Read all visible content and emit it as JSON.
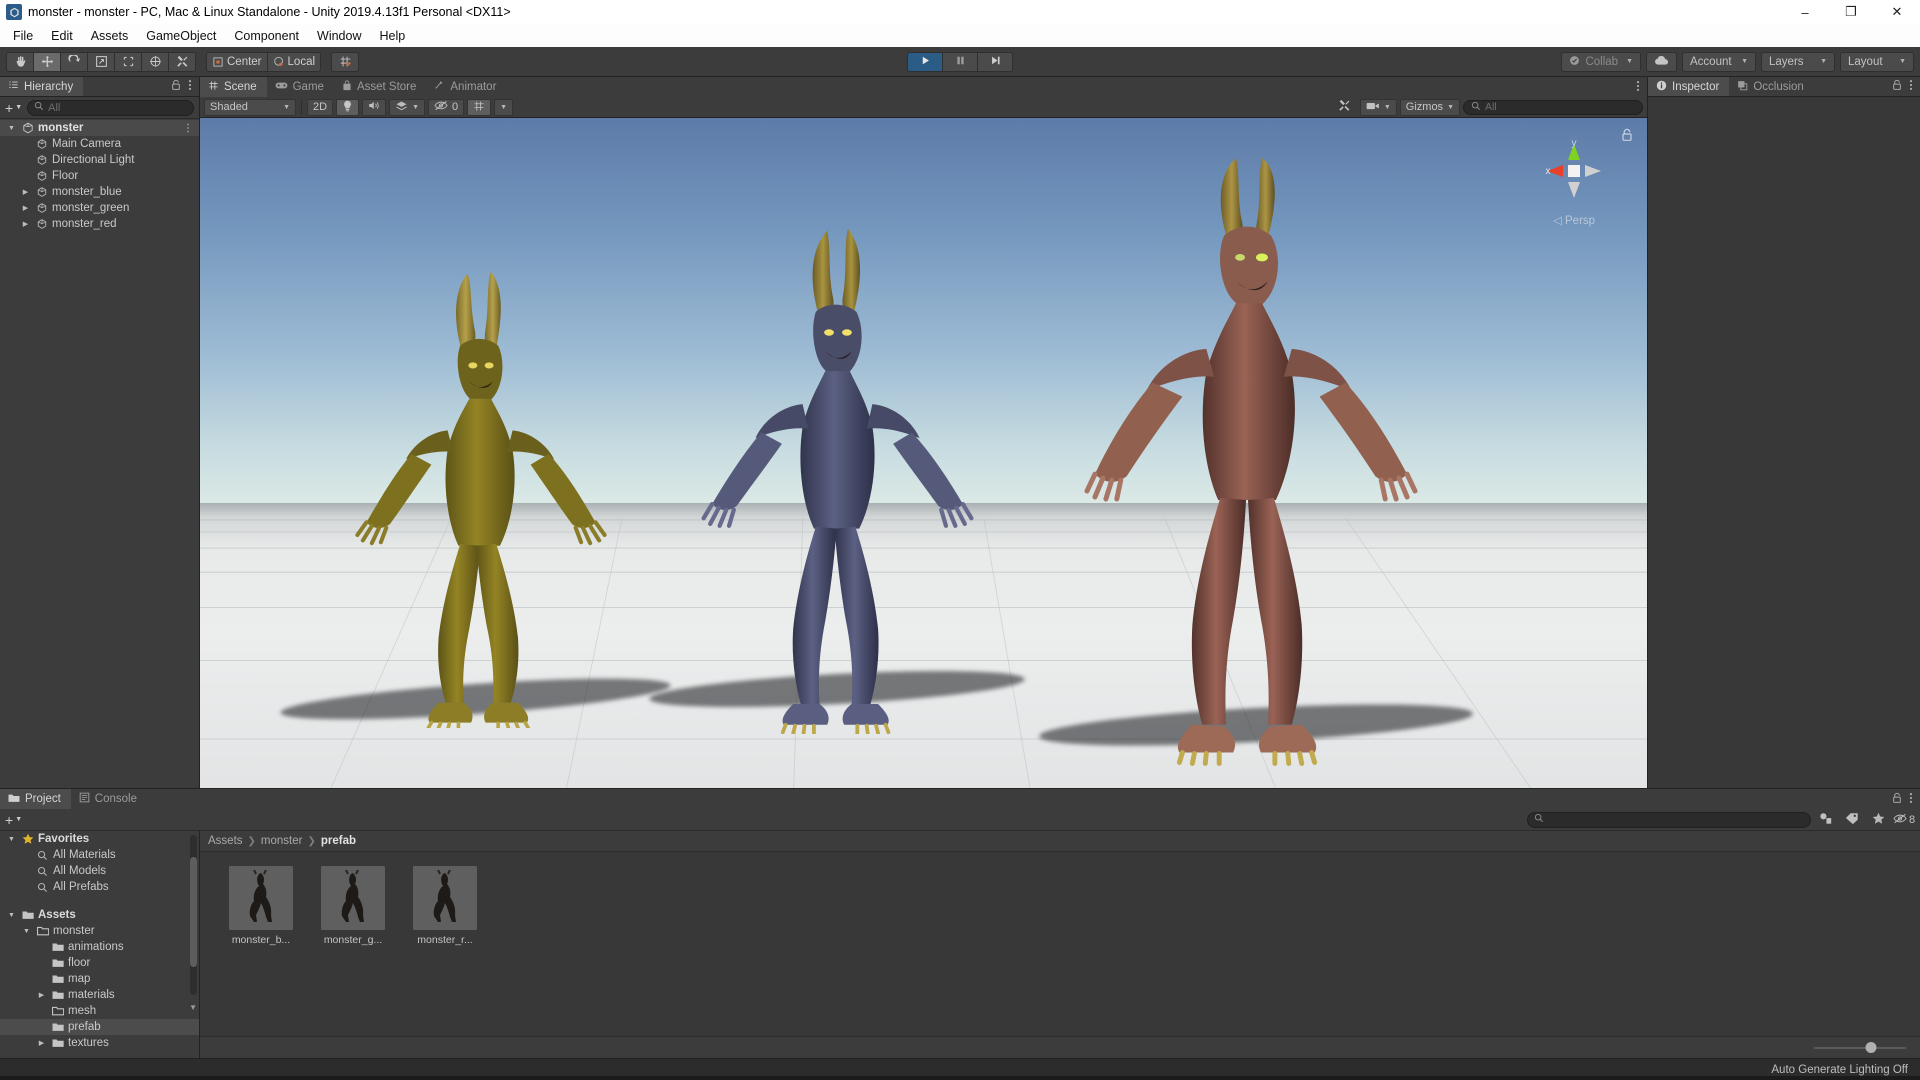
{
  "window": {
    "title": "monster - monster - PC, Mac & Linux Standalone - Unity 2019.4.13f1 Personal <DX11>",
    "app_icon": "unity-icon",
    "minimize": "–",
    "maximize": "❐",
    "close": "✕"
  },
  "menu": {
    "items": [
      "File",
      "Edit",
      "Assets",
      "GameObject",
      "Component",
      "Window",
      "Help"
    ]
  },
  "toolbar": {
    "tools": [
      {
        "name": "hand-tool",
        "icon": "hand-icon",
        "active": false
      },
      {
        "name": "move-tool",
        "icon": "move-icon",
        "active": true
      },
      {
        "name": "rotate-tool",
        "icon": "rotate-icon",
        "active": false
      },
      {
        "name": "scale-tool",
        "icon": "scale-icon",
        "active": false
      },
      {
        "name": "rect-tool",
        "icon": "rect-transform-icon",
        "active": false
      },
      {
        "name": "transform-tool",
        "icon": "transform-icon",
        "active": false
      },
      {
        "name": "custom-editor-tool",
        "icon": "wrench-icon",
        "active": false
      }
    ],
    "pivot_mode": "Center",
    "pivot_rotation": "Local",
    "grid_snap_icon": "grid-snap-icon",
    "play": "play-icon",
    "pause": "pause-icon",
    "step": "step-icon",
    "collab": "Collab",
    "cloud_icon": "cloud-icon",
    "account": "Account",
    "layers": "Layers",
    "layout": "Layout"
  },
  "hierarchy": {
    "tab": "Hierarchy",
    "tab_icon": "hierarchy-icon",
    "lock_icon": "lock-icon",
    "menu_icon": "kebab-icon",
    "add_label": "+",
    "search_placeholder": "All",
    "search_value": "",
    "items": [
      {
        "label": "monster",
        "depth": 0,
        "icon": "scene-icon",
        "expanded": true,
        "is_scene": true,
        "has_children": true
      },
      {
        "label": "Main Camera",
        "depth": 1,
        "icon": "gameobject-icon",
        "has_children": false
      },
      {
        "label": "Directional Light",
        "depth": 1,
        "icon": "gameobject-icon",
        "has_children": false
      },
      {
        "label": "Floor",
        "depth": 1,
        "icon": "gameobject-icon",
        "has_children": false
      },
      {
        "label": "monster_blue",
        "depth": 1,
        "icon": "gameobject-icon",
        "has_children": true
      },
      {
        "label": "monster_green",
        "depth": 1,
        "icon": "gameobject-icon",
        "has_children": true
      },
      {
        "label": "monster_red",
        "depth": 1,
        "icon": "gameobject-icon",
        "has_children": true
      }
    ]
  },
  "scene_view": {
    "tabs": [
      {
        "label": "Scene",
        "icon": "scene-tab-icon",
        "active": true
      },
      {
        "label": "Game",
        "icon": "game-tab-icon",
        "active": false
      },
      {
        "label": "Asset Store",
        "icon": "store-tab-icon",
        "active": false
      },
      {
        "label": "Animator",
        "icon": "animator-tab-icon",
        "active": false
      }
    ],
    "menu_icon": "kebab-icon",
    "draw_mode": "Shaded",
    "mode_2d": "2D",
    "lighting_icon": "lightbulb-icon",
    "audio_icon": "audio-icon",
    "fx_icon": "effects-icon",
    "hidden_count": "0",
    "hidden_icon": "eye-off-icon",
    "grid_icon": "grid-icon",
    "tools_icon": "tools-icon",
    "camera_icon": "camera-icon",
    "gizmos": "Gizmos",
    "search_placeholder": "All",
    "search_value": "",
    "projection": "Persp",
    "projection_prefix": "◁",
    "axis_x": "x",
    "axis_y": "y",
    "lock_icon": "lock-open-icon",
    "objects": [
      {
        "name": "monster_green",
        "color": "#8a7a2e"
      },
      {
        "name": "monster_blue",
        "color": "#4e5370"
      },
      {
        "name": "monster_red",
        "color": "#8e5a4e"
      }
    ]
  },
  "inspector": {
    "tabs": [
      {
        "label": "Inspector",
        "icon": "info-icon",
        "active": true
      },
      {
        "label": "Occlusion",
        "icon": "occlusion-icon",
        "active": false
      }
    ],
    "lock_icon": "lock-icon",
    "menu_icon": "kebab-icon"
  },
  "project": {
    "tabs": [
      {
        "label": "Project",
        "icon": "folder-icon",
        "active": true
      },
      {
        "label": "Console",
        "icon": "console-icon",
        "active": false
      }
    ],
    "lock_icon": "lock-icon",
    "menu_icon": "kebab-icon",
    "add_label": "+",
    "search_placeholder": "",
    "search_value": "",
    "filter_type_icon": "filter-type-icon",
    "filter_label_icon": "filter-label-icon",
    "favorite_icon": "star-icon",
    "hidden_count": "8",
    "hidden_icon": "eye-off-icon",
    "tree": [
      {
        "label": "Favorites",
        "depth": 0,
        "icon": "star-icon",
        "expanded": true,
        "bold": true,
        "has_children": true
      },
      {
        "label": "All Materials",
        "depth": 1,
        "icon": "search-icon",
        "has_children": false
      },
      {
        "label": "All Models",
        "depth": 1,
        "icon": "search-icon",
        "has_children": false
      },
      {
        "label": "All Prefabs",
        "depth": 1,
        "icon": "search-icon",
        "has_children": false
      },
      {
        "label": "",
        "depth": 0,
        "icon": "spacer",
        "spacer": true
      },
      {
        "label": "Assets",
        "depth": 0,
        "icon": "folder-icon",
        "expanded": true,
        "bold": true,
        "has_children": true
      },
      {
        "label": "monster",
        "depth": 1,
        "icon": "folder-open-icon",
        "expanded": true,
        "has_children": true
      },
      {
        "label": "animations",
        "depth": 2,
        "icon": "folder-icon",
        "has_children": false
      },
      {
        "label": "floor",
        "depth": 2,
        "icon": "folder-icon",
        "has_children": false
      },
      {
        "label": "map",
        "depth": 2,
        "icon": "folder-icon",
        "has_children": false
      },
      {
        "label": "materials",
        "depth": 2,
        "icon": "folder-icon",
        "has_children": true
      },
      {
        "label": "mesh",
        "depth": 2,
        "icon": "folder-open-icon",
        "has_children": false
      },
      {
        "label": "prefab",
        "depth": 2,
        "icon": "folder-icon",
        "selected": true,
        "has_children": false
      },
      {
        "label": "textures",
        "depth": 2,
        "icon": "folder-icon",
        "has_children": true
      }
    ],
    "breadcrumb": [
      "Assets",
      "monster",
      "prefab"
    ],
    "assets": [
      {
        "label": "monster_b...",
        "icon": "prefab-thumb"
      },
      {
        "label": "monster_g...",
        "icon": "prefab-thumb"
      },
      {
        "label": "monster_r...",
        "icon": "prefab-thumb"
      }
    ],
    "zoom_value": 62
  },
  "status": {
    "message": "Auto Generate Lighting Off"
  }
}
